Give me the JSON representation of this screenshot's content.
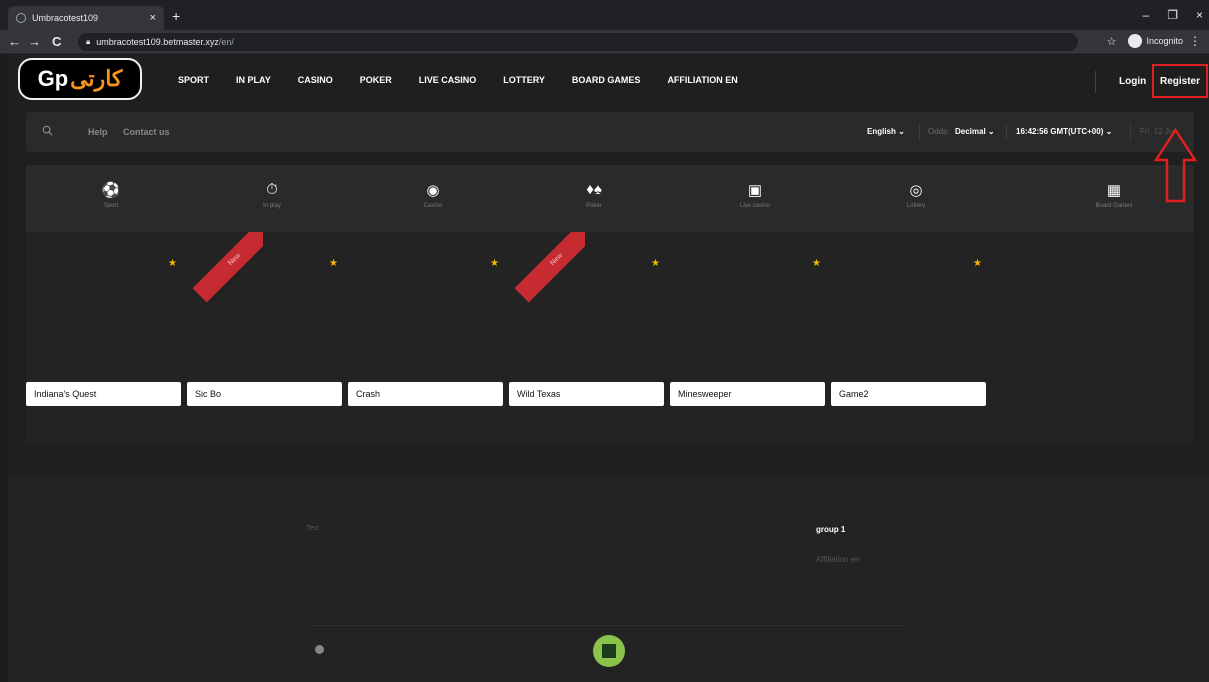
{
  "browser": {
    "tab_title": "Umbracotest109",
    "tab_close": "×",
    "new_tab": "+",
    "back": "←",
    "forward": "→",
    "reload": "C",
    "url_host": "umbracotest109.betmaster.xyz",
    "url_path": "/en/",
    "incognito": "Incognito",
    "minimize": "–",
    "restore": "❐",
    "close": "×"
  },
  "nav": {
    "logo_text": "کارتی",
    "logo_prefix": "Gp",
    "items": [
      "SPORT",
      "IN PLAY",
      "CASINO",
      "POKER",
      "LIVE CASINO",
      "LOTTERY",
      "BOARD GAMES",
      "AFFILIATION EN"
    ],
    "login": "Login",
    "register": "Register"
  },
  "subbar": {
    "help": "Help",
    "contact": "Contact us",
    "language": "English ⌄",
    "odds_label": "Odds:",
    "odds_value": "Decimal ⌄",
    "clock": "16:42:56  GMT(UTC+00) ⌄",
    "date": "Fri, 12 Jun"
  },
  "categories": [
    {
      "label": "Sport",
      "icon": "⚽"
    },
    {
      "label": "In play",
      "icon": "⏱"
    },
    {
      "label": "Casino",
      "icon": "◉"
    },
    {
      "label": "Poker",
      "icon": "♦♠"
    },
    {
      "label": "Live casino",
      "icon": "▣"
    },
    {
      "label": "Lottery",
      "icon": "◎"
    },
    {
      "label": "Board Games",
      "icon": "▦"
    }
  ],
  "games": [
    {
      "name": "Indiana's Quest",
      "badge": ""
    },
    {
      "name": "Sic Bo",
      "badge": "New"
    },
    {
      "name": "Crash",
      "badge": ""
    },
    {
      "name": "Wild Texas",
      "badge": "New"
    },
    {
      "name": "Minesweeper",
      "badge": ""
    },
    {
      "name": "Game2",
      "badge": ""
    }
  ],
  "footer": {
    "test": "Test",
    "group": "group 1",
    "affiliation": "Affiliation en"
  },
  "colors": {
    "accent_red": "#e02020",
    "ribbon": "#c62b32",
    "star": "#f5b800"
  }
}
